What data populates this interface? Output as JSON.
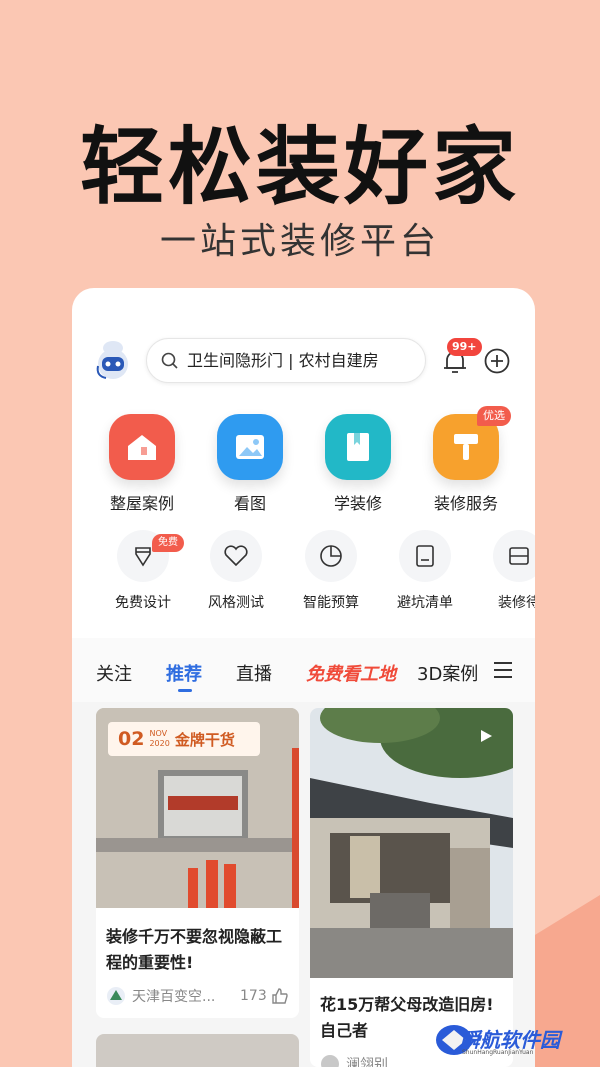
{
  "hero": {
    "title": "轻松装好家",
    "subtitle": "一站式装修平台"
  },
  "header": {
    "search_placeholder": "卫生间隐形门 | 农村自建房",
    "notification_badge": "99+"
  },
  "services": [
    {
      "label": "整屋案例",
      "icon": "house-icon",
      "color": "#f25c4c"
    },
    {
      "label": "看图",
      "icon": "image-icon",
      "color": "#2f9bf0"
    },
    {
      "label": "学装修",
      "icon": "book-icon",
      "color": "#22b8c7"
    },
    {
      "label": "装修服务",
      "icon": "paint-roller-icon",
      "color": "#f7a12d",
      "tag": "优选"
    }
  ],
  "tools": [
    {
      "label": "免费设计",
      "icon": "pen-icon",
      "tag": "免费"
    },
    {
      "label": "风格测试",
      "icon": "heart-icon"
    },
    {
      "label": "智能预算",
      "icon": "pie-chart-icon"
    },
    {
      "label": "避坑清单",
      "icon": "checklist-icon"
    },
    {
      "label": "装修待",
      "icon": "cabinet-icon"
    }
  ],
  "feed_tabs": [
    {
      "label": "关注"
    },
    {
      "label": "推荐",
      "active": true
    },
    {
      "label": "直播"
    },
    {
      "label": "免费看工地",
      "promo": true
    },
    {
      "label": "3D案例"
    }
  ],
  "cards": [
    {
      "date_day": "02",
      "date_month": "NOV",
      "date_year": "2020",
      "tag": "金牌干货",
      "title": "装修千万不要忽视隐蔽工程的重要性!",
      "author": "天津百变空...",
      "likes": "173"
    },
    {
      "title": "花15万帮父母改造旧房!自己者",
      "author": "澜翎别"
    }
  ],
  "watermark": {
    "name": "瞬航软件园",
    "pinyin": "ShunHangRuanJianYuan"
  }
}
